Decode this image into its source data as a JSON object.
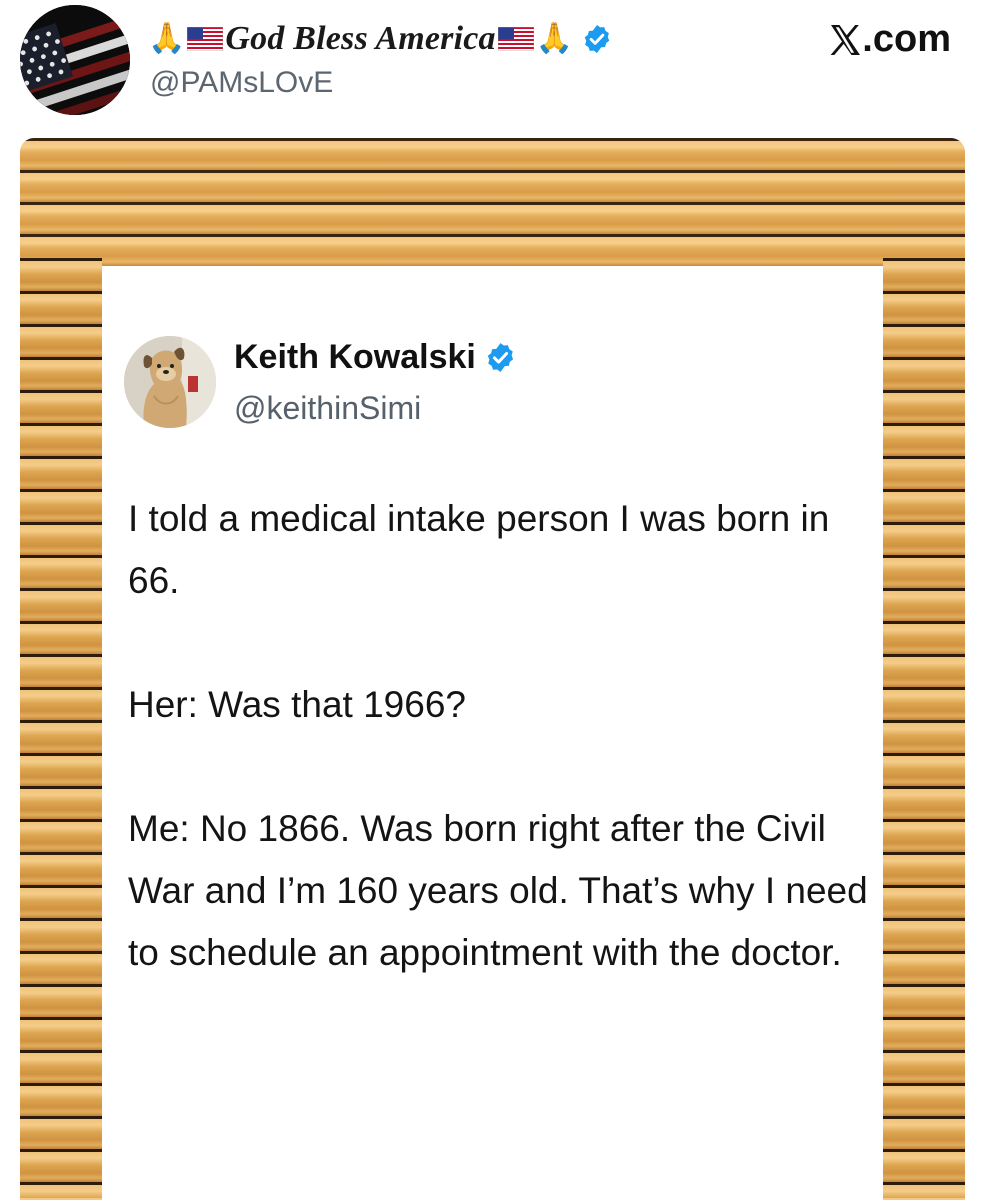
{
  "header": {
    "display_name": "God Bless America",
    "name_prefix_emoji": "🙏",
    "name_suffix_emoji": "🙏",
    "handle": "@PAMsLOvE",
    "site": {
      "text": ".com",
      "logo_icon": "x-logo-icon"
    },
    "avatar_icon": "american-flag-avatar",
    "badge_icon": "verified-badge-icon",
    "badge_color": "#1d9bf0"
  },
  "image": {
    "background": "wood-plank-icon",
    "tweet": {
      "author_name": "Keith Kowalski",
      "author_handle": "@keithinSimi",
      "avatar_icon": "dog-avatar",
      "badge_icon": "verified-badge-icon",
      "paragraphs": [
        "I told a medical intake person I was born in 66.",
        "Her: Was that 1966?",
        "Me: No 1866. Was born right after the Civil War and I’m 160 years old. That’s why I need to schedule an appointment with the doctor."
      ]
    }
  }
}
